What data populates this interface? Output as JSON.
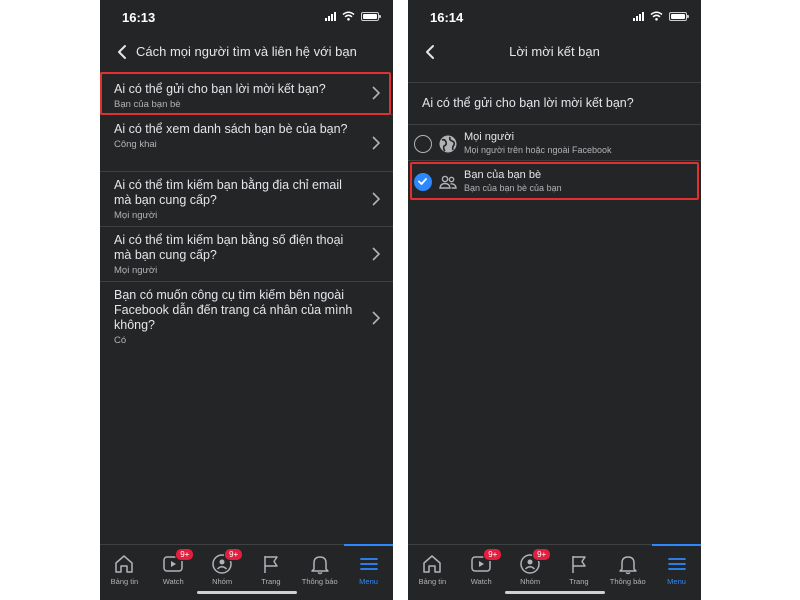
{
  "left_screen": {
    "status_time": "16:13",
    "header_title": "Cách mọi người tìm và liên hệ với bạn",
    "items": [
      {
        "question": "Ai có thể gửi cho bạn lời mời kết bạn?",
        "value": "Bạn của bạn bè"
      },
      {
        "question": "Ai có thể xem danh sách bạn bè của bạn?",
        "value": "Công khai"
      },
      {
        "question": "Ai có thể tìm kiếm bạn bằng địa chỉ email mà bạn cung cấp?",
        "value": "Mọi người"
      },
      {
        "question": "Ai có thể tìm kiếm bạn bằng số điện thoại mà bạn cung cấp?",
        "value": "Mọi người"
      },
      {
        "question": "Bạn có muốn công cụ tìm kiếm bên ngoài Facebook dẫn đến trang cá nhân của mình không?",
        "value": "Có"
      }
    ]
  },
  "right_screen": {
    "status_time": "16:14",
    "header_title": "Lời mời kết bạn",
    "question": "Ai có thể gửi cho bạn lời mời kết bạn?",
    "options": [
      {
        "title": "Mọi người",
        "subtitle": "Mọi người trên hoặc ngoài Facebook",
        "selected": false,
        "icon": "globe-icon"
      },
      {
        "title": "Bạn của bạn bè",
        "subtitle": "Bạn của bạn bè của bạn",
        "selected": true,
        "icon": "friends-icon"
      }
    ]
  },
  "bottom_nav": {
    "items": [
      {
        "label": "Bảng tin",
        "icon": "home-icon"
      },
      {
        "label": "Watch",
        "icon": "video-icon",
        "badge": "9+"
      },
      {
        "label": "Nhóm",
        "icon": "groups-icon",
        "badge": "9+"
      },
      {
        "label": "Trang",
        "icon": "flag-icon"
      },
      {
        "label": "Thông báo",
        "icon": "bell-icon"
      },
      {
        "label": "Menu",
        "icon": "menu-icon",
        "active": true
      }
    ]
  },
  "colors": {
    "background": "#242526",
    "accent": "#2d88ff",
    "highlight": "#e03030",
    "badge": "#e41e3f"
  }
}
